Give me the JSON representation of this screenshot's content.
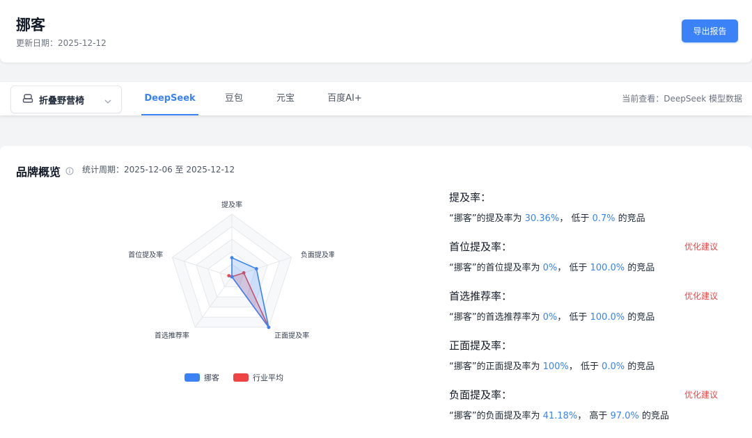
{
  "header": {
    "title": "挪客",
    "update_date": "更新日期：2025-12-12",
    "export_label": "导出报告",
    "accent": "#3b82f6"
  },
  "nav": {
    "product": "折叠野营椅",
    "tabs": [
      "DeepSeek",
      "豆包",
      "元宝",
      "百度AI+"
    ],
    "active_tab": "DeepSeek",
    "viewing": "当前查看：DeepSeek 模型数据"
  },
  "overview": {
    "title": "品牌概览",
    "period": "统计周期：2025-12-06 至 2025-12-12"
  },
  "chart_data": {
    "type": "radar",
    "axes": [
      "提及率",
      "负面提及率",
      "正面提及率",
      "首选推荐率",
      "首位提及率"
    ],
    "max": 100,
    "series": [
      {
        "name": "挪客",
        "color": "#3b82f6",
        "values": [
          30.36,
          41.18,
          100,
          0,
          0
        ]
      },
      {
        "name": "行业平均",
        "color": "#ef4444",
        "values": [
          0,
          20,
          100,
          0,
          5
        ]
      }
    ]
  },
  "metrics": [
    {
      "title": "提及率：",
      "prefix": "“挪客”的提及率为 ",
      "value": "30.36%",
      "cmp": "， 低于 ",
      "rank": "0.7%",
      "suffix": " 的竞品",
      "action": ""
    },
    {
      "title": "首位提及率：",
      "prefix": "“挪客”的首位提及率为 ",
      "value": "0%",
      "cmp": "， 低于 ",
      "rank": "100.0%",
      "suffix": " 的竞品",
      "action": "优化建议"
    },
    {
      "title": "首选推荐率：",
      "prefix": "“挪客”的首选推荐率为 ",
      "value": "0%",
      "cmp": "， 低于 ",
      "rank": "100.0%",
      "suffix": " 的竞品",
      "action": "优化建议"
    },
    {
      "title": "正面提及率：",
      "prefix": "“挪客”的正面提及率为 ",
      "value": "100%",
      "cmp": "， 低于 ",
      "rank": "0.0%",
      "suffix": " 的竞品",
      "action": ""
    },
    {
      "title": "负面提及率：",
      "prefix": "“挪客”的负面提及率为 ",
      "value": "41.18%",
      "cmp": "， 高于 ",
      "rank": "97.0%",
      "suffix": " 的竞品",
      "action": "优化建议"
    }
  ]
}
